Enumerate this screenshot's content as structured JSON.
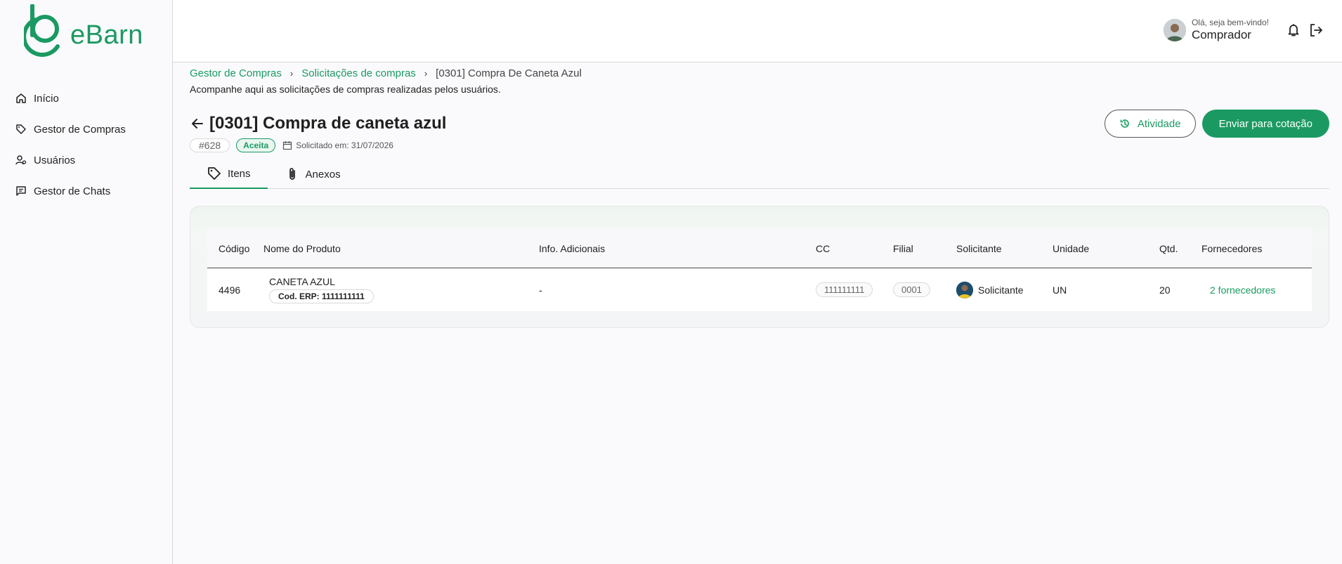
{
  "brand": {
    "name": "eBarn",
    "color": "#1a9a62"
  },
  "sidebar": {
    "items": [
      {
        "label": "Início",
        "icon": "home-icon"
      },
      {
        "label": "Gestor de Compras",
        "icon": "tag-icon"
      },
      {
        "label": "Usuários",
        "icon": "users-icon"
      },
      {
        "label": "Gestor de Chats",
        "icon": "chat-icon"
      }
    ]
  },
  "header": {
    "greeting": "Olá, seja bem-vindo!",
    "role": "Comprador"
  },
  "breadcrumb": {
    "items": [
      "Gestor de Compras",
      "Solicitações de compras"
    ],
    "current": "[0301] Compra De Caneta Azul"
  },
  "page": {
    "subtitle": "Acompanhe aqui as solicitações de compras realizadas pelos usuários.",
    "title": "[0301] Compra de caneta azul",
    "id": "#628",
    "status": "Aceita",
    "requested": "Solicitado em: 31/07/2026"
  },
  "actions": {
    "activity": "Atividade",
    "send": "Enviar para cotação"
  },
  "tabs": [
    {
      "label": "Itens",
      "icon": "tag-icon"
    },
    {
      "label": "Anexos",
      "icon": "paperclip-icon"
    }
  ],
  "table": {
    "headers": [
      "Código",
      "Nome do Produto",
      "Info. Adicionais",
      "CC",
      "Filial",
      "Solicitante",
      "Unidade",
      "Qtd.",
      "Fornecedores"
    ],
    "rows": [
      {
        "code": "4496",
        "product": "CANETA AZUL",
        "erp": "Cod. ERP: 1111111111",
        "info": "-",
        "cc": "111111111",
        "filial": "0001",
        "requester": "Solicitante",
        "unit": "UN",
        "qty": "20",
        "suppliers": "2 fornecedores"
      }
    ]
  }
}
